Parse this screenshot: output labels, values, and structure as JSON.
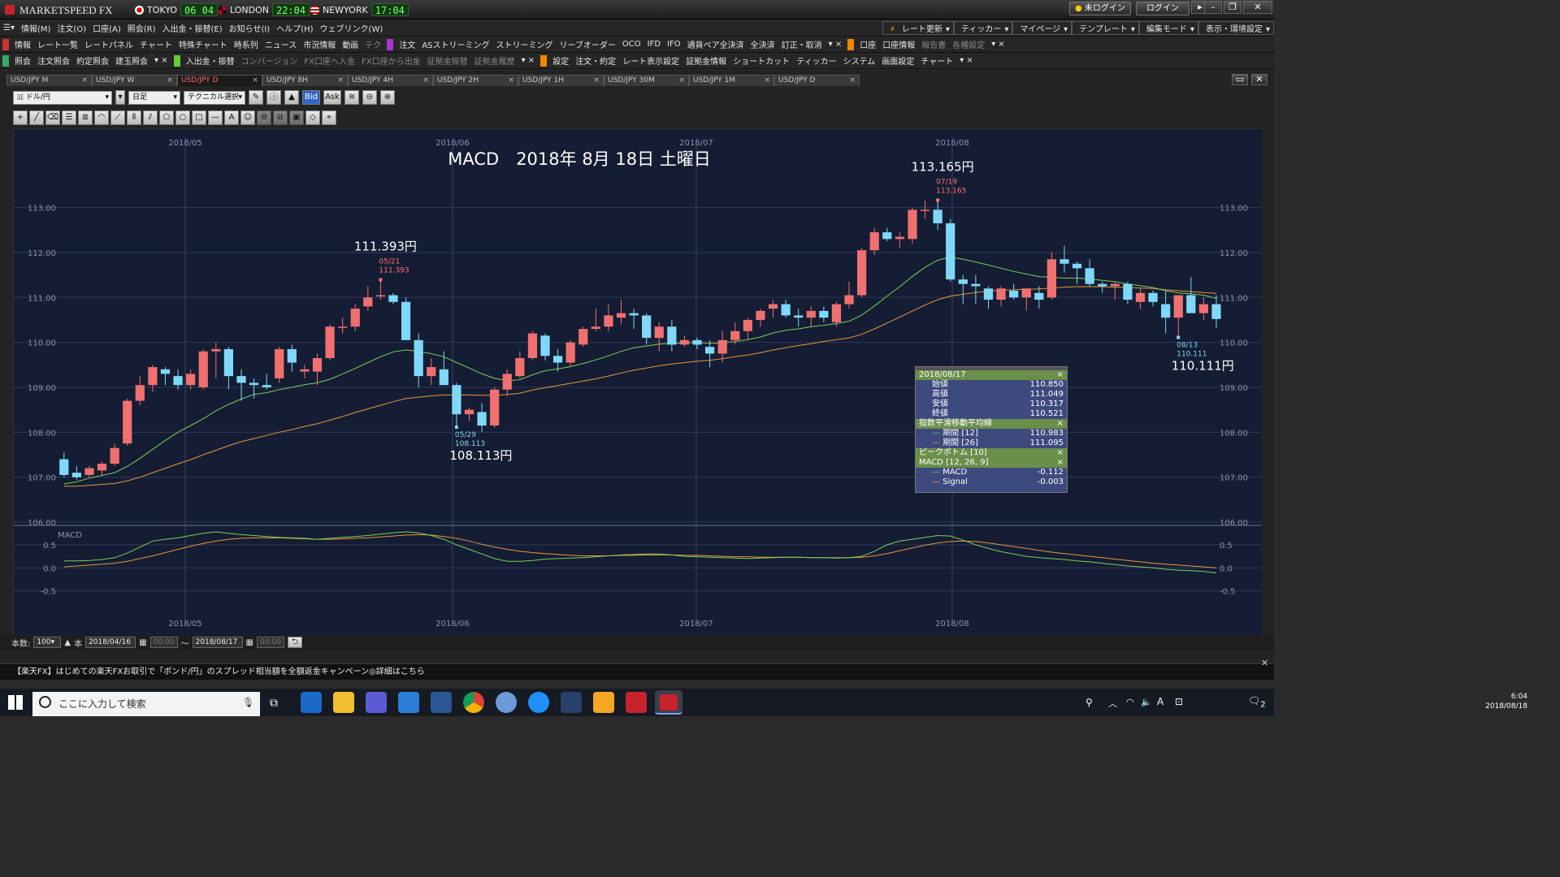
{
  "titlebar": {
    "brand": "MARKETSPEED FX",
    "clocks": [
      {
        "city": "TOKYO",
        "time": "06 04"
      },
      {
        "city": "LONDON",
        "time": "22:04"
      },
      {
        "city": "NEWYORK",
        "time": "17:04"
      }
    ],
    "login_status": "未ログイン",
    "login_button": "ログイン"
  },
  "menu1": [
    "情報(M)",
    "注文(O)",
    "口座(A)",
    "照会(R)",
    "入出金・振替(E)",
    "お知らせ(I)",
    "ヘルプ(H)",
    "ウェブリンク(W)"
  ],
  "menu1_right": [
    "レート更新",
    "ティッカー",
    "マイページ",
    "テンプレート",
    "編集モード",
    "表示・環境設定"
  ],
  "row2_info": [
    "情報",
    "レート一覧",
    "レートパネル",
    "チャート",
    "特殊チャート",
    "時系列",
    "ニュース",
    "市況情報",
    "動画",
    "テク"
  ],
  "row2_order": [
    "注文",
    "ASストリーミング",
    "ストリーミング",
    "リーブオーダー",
    "OCO",
    "IFD",
    "IFO",
    "通貨ペア全決済",
    "全決済",
    "訂正・取消"
  ],
  "row2_account": [
    "口座",
    "口座情報",
    "報告書",
    "各種設定"
  ],
  "row3_query": [
    "照会",
    "注文照会",
    "約定照会",
    "建玉照会"
  ],
  "row3_transfer": [
    "入出金・振替",
    "コンバージョン",
    "FX口座へ入金",
    "FX口座から出金",
    "証拠金振替",
    "証拠金履歴"
  ],
  "row3_settings": [
    "設定",
    "注文・約定",
    "レート表示設定",
    "証拠金情報",
    "ショートカット",
    "ティッカー",
    "システム",
    "画面設定",
    "チャート"
  ],
  "tabs": [
    "USD/JPY M",
    "USD/JPY W",
    "USD/JPY D",
    "USD/JPY 8H",
    "USD/JPY 4H",
    "USD/JPY 2H",
    "USD/JPY 1H",
    "USD/JPY 30M",
    "USD/JPY 1M",
    "USD/JPY D"
  ],
  "active_tab": 2,
  "toolbar": {
    "pair": "ドル/円",
    "period": "日足",
    "technical": "テクニカル選択",
    "bid": "Bid",
    "ask": "Ask"
  },
  "chart_data": {
    "type": "candlestick",
    "title": "MACD　2018年 8月 18日 土曜日",
    "x_ticks": [
      "2018/05",
      "2018/06",
      "2018/07",
      "2018/08"
    ],
    "ylim": [
      106.0,
      113.3
    ],
    "y_ticks": [
      "113.00",
      "112.00",
      "111.00",
      "110.00",
      "109.00",
      "108.00",
      "107.00",
      "106.00"
    ],
    "candles": [
      [
        107.4,
        107.55,
        107.0,
        107.05
      ],
      [
        107.1,
        107.25,
        106.95,
        107.0
      ],
      [
        107.05,
        107.25,
        107.0,
        107.2
      ],
      [
        107.15,
        107.35,
        107.05,
        107.3
      ],
      [
        107.3,
        107.75,
        107.25,
        107.65
      ],
      [
        107.75,
        108.75,
        107.7,
        108.7
      ],
      [
        108.7,
        109.25,
        108.6,
        109.05
      ],
      [
        109.05,
        109.5,
        108.9,
        109.45
      ],
      [
        109.4,
        109.45,
        109.05,
        109.3
      ],
      [
        109.25,
        109.4,
        108.95,
        109.05
      ],
      [
        109.05,
        109.4,
        108.95,
        109.3
      ],
      [
        109.0,
        109.85,
        108.95,
        109.8
      ],
      [
        109.8,
        110.0,
        109.2,
        109.85
      ],
      [
        109.85,
        109.9,
        108.95,
        109.25
      ],
      [
        109.25,
        109.4,
        108.7,
        109.1
      ],
      [
        109.1,
        109.2,
        108.75,
        109.05
      ],
      [
        109.05,
        109.3,
        108.95,
        109.0
      ],
      [
        109.2,
        109.9,
        109.1,
        109.85
      ],
      [
        109.85,
        109.95,
        109.35,
        109.55
      ],
      [
        109.35,
        109.5,
        109.2,
        109.4
      ],
      [
        109.35,
        109.75,
        109.05,
        109.65
      ],
      [
        109.65,
        110.4,
        109.6,
        110.35
      ],
      [
        110.35,
        110.55,
        110.2,
        110.35
      ],
      [
        110.35,
        110.85,
        110.25,
        110.75
      ],
      [
        110.8,
        111.25,
        110.7,
        111.0
      ],
      [
        111.05,
        111.39,
        110.95,
        111.05
      ],
      [
        111.05,
        111.1,
        110.85,
        110.9
      ],
      [
        110.9,
        111.0,
        110.05,
        110.05
      ],
      [
        110.05,
        110.2,
        109.0,
        109.25
      ],
      [
        109.25,
        109.65,
        109.05,
        109.45
      ],
      [
        109.4,
        109.8,
        109.05,
        109.05
      ],
      [
        109.05,
        109.1,
        108.11,
        108.4
      ],
      [
        108.4,
        108.55,
        108.25,
        108.5
      ],
      [
        108.45,
        108.65,
        108.0,
        108.15
      ],
      [
        108.15,
        109.0,
        108.1,
        108.95
      ],
      [
        108.95,
        109.4,
        108.8,
        109.3
      ],
      [
        109.25,
        109.8,
        109.2,
        109.65
      ],
      [
        109.65,
        110.25,
        109.6,
        110.2
      ],
      [
        110.15,
        110.2,
        109.6,
        109.7
      ],
      [
        109.7,
        109.85,
        109.35,
        109.55
      ],
      [
        109.55,
        110.05,
        109.45,
        110.0
      ],
      [
        109.95,
        110.35,
        109.9,
        110.3
      ],
      [
        110.3,
        110.75,
        110.25,
        110.35
      ],
      [
        110.35,
        110.85,
        110.25,
        110.6
      ],
      [
        110.55,
        110.95,
        110.4,
        110.65
      ],
      [
        110.65,
        110.75,
        110.3,
        110.6
      ],
      [
        110.6,
        110.65,
        109.95,
        110.1
      ],
      [
        110.1,
        110.45,
        109.8,
        110.35
      ],
      [
        110.35,
        110.5,
        109.8,
        109.95
      ],
      [
        109.95,
        110.15,
        109.9,
        110.05
      ],
      [
        110.05,
        110.1,
        109.85,
        109.95
      ],
      [
        109.9,
        110.05,
        109.45,
        109.75
      ],
      [
        109.75,
        110.25,
        109.55,
        110.05
      ],
      [
        110.05,
        110.45,
        109.95,
        110.25
      ],
      [
        110.25,
        110.55,
        110.05,
        110.5
      ],
      [
        110.5,
        110.75,
        110.35,
        110.7
      ],
      [
        110.75,
        110.95,
        110.55,
        110.85
      ],
      [
        110.85,
        110.95,
        110.55,
        110.6
      ],
      [
        110.6,
        110.75,
        110.35,
        110.55
      ],
      [
        110.55,
        110.8,
        110.35,
        110.7
      ],
      [
        110.7,
        110.8,
        110.45,
        110.55
      ],
      [
        110.45,
        110.9,
        110.35,
        110.85
      ],
      [
        110.85,
        111.35,
        110.75,
        111.05
      ],
      [
        111.05,
        112.1,
        111.0,
        112.05
      ],
      [
        112.05,
        112.55,
        111.95,
        112.45
      ],
      [
        112.45,
        112.55,
        112.25,
        112.3
      ],
      [
        112.3,
        112.45,
        112.1,
        112.35
      ],
      [
        112.3,
        113.0,
        112.2,
        112.95
      ],
      [
        112.95,
        113.15,
        112.75,
        112.95
      ],
      [
        112.95,
        113.17,
        112.5,
        112.65
      ],
      [
        112.65,
        112.75,
        111.35,
        111.4
      ],
      [
        111.4,
        111.5,
        110.85,
        111.3
      ],
      [
        111.3,
        111.5,
        110.85,
        111.25
      ],
      [
        111.2,
        111.25,
        110.75,
        110.95
      ],
      [
        110.95,
        111.25,
        110.8,
        111.2
      ],
      [
        111.15,
        111.3,
        110.95,
        111.0
      ],
      [
        111.0,
        111.2,
        110.7,
        111.2
      ],
      [
        111.1,
        111.25,
        110.75,
        110.95
      ],
      [
        111.0,
        112.0,
        110.95,
        111.85
      ],
      [
        111.85,
        112.15,
        111.55,
        111.75
      ],
      [
        111.75,
        111.8,
        111.3,
        111.65
      ],
      [
        111.65,
        111.85,
        111.25,
        111.3
      ],
      [
        111.3,
        111.35,
        111.1,
        111.25
      ],
      [
        111.25,
        111.35,
        110.95,
        111.3
      ],
      [
        111.3,
        111.35,
        110.85,
        110.95
      ],
      [
        110.9,
        111.2,
        110.75,
        111.1
      ],
      [
        111.1,
        111.15,
        110.8,
        110.9
      ],
      [
        110.85,
        111.15,
        110.2,
        110.55
      ],
      [
        110.55,
        111.0,
        110.11,
        111.05
      ],
      [
        111.05,
        111.45,
        110.7,
        110.65
      ],
      [
        110.65,
        111.0,
        110.5,
        110.85
      ],
      [
        110.85,
        111.05,
        110.32,
        110.52
      ]
    ],
    "ema12": [
      106.85,
      106.9,
      106.98,
      107.04,
      107.1,
      107.24,
      107.42,
      107.62,
      107.82,
      108.0,
      108.15,
      108.3,
      108.48,
      108.62,
      108.74,
      108.84,
      108.88,
      108.95,
      109.0,
      109.06,
      109.1,
      109.18,
      109.3,
      109.42,
      109.55,
      109.68,
      109.79,
      109.83,
      109.8,
      109.75,
      109.68,
      109.55,
      109.43,
      109.3,
      109.2,
      109.15,
      109.17,
      109.28,
      109.37,
      109.41,
      109.46,
      109.53,
      109.61,
      109.7,
      109.8,
      109.88,
      109.92,
      109.96,
      109.98,
      109.99,
      110.0,
      109.98,
      109.99,
      110.02,
      110.06,
      110.12,
      110.21,
      110.27,
      110.3,
      110.35,
      110.38,
      110.42,
      110.47,
      110.61,
      110.81,
      111.03,
      111.24,
      111.47,
      111.67,
      111.83,
      111.9,
      111.85,
      111.79,
      111.72,
      111.65,
      111.58,
      111.52,
      111.46,
      111.45,
      111.43,
      111.43,
      111.41,
      111.38,
      111.35,
      111.3,
      111.26,
      111.22,
      111.15,
      111.1,
      111.08,
      111.05,
      110.98
    ],
    "ema26": [
      106.8,
      106.8,
      106.82,
      106.84,
      106.86,
      106.92,
      107.0,
      107.1,
      107.2,
      107.3,
      107.39,
      107.5,
      107.6,
      107.7,
      107.79,
      107.86,
      107.93,
      108.0,
      108.06,
      108.13,
      108.19,
      108.27,
      108.35,
      108.44,
      108.52,
      108.6,
      108.68,
      108.75,
      108.78,
      108.81,
      108.83,
      108.83,
      108.83,
      108.82,
      108.82,
      108.84,
      108.87,
      108.94,
      108.99,
      109.04,
      109.09,
      109.14,
      109.19,
      109.25,
      109.32,
      109.38,
      109.43,
      109.48,
      109.52,
      109.55,
      109.58,
      109.6,
      109.64,
      109.68,
      109.72,
      109.77,
      109.83,
      109.88,
      109.93,
      109.97,
      110.02,
      110.06,
      110.1,
      110.18,
      110.3,
      110.43,
      110.56,
      110.7,
      110.83,
      110.95,
      111.03,
      111.07,
      111.11,
      111.14,
      111.16,
      111.17,
      111.18,
      111.19,
      111.21,
      111.23,
      111.24,
      111.24,
      111.24,
      111.23,
      111.22,
      111.21,
      111.2,
      111.17,
      111.15,
      111.13,
      111.11,
      111.09
    ],
    "peaks": [
      {
        "idx": 25,
        "date": "05/21",
        "price": "111.393",
        "label": "111.393円",
        "kind": "high"
      },
      {
        "idx": 31,
        "date": "05/29",
        "price": "108.113",
        "label": "108.113円",
        "kind": "low"
      },
      {
        "idx": 69,
        "date": "07/19",
        "price": "113.165",
        "label": "113.165円",
        "kind": "high"
      },
      {
        "idx": 88,
        "date": "08/13",
        "price": "110.111",
        "label": "110.111円",
        "kind": "low"
      }
    ],
    "macd": {
      "label": "MACD",
      "y_ticks": [
        "0.5",
        "0.0",
        "-0.5"
      ],
      "ylim": [
        -0.7,
        0.85
      ],
      "macd": [
        0.15,
        0.15,
        0.16,
        0.18,
        0.22,
        0.32,
        0.45,
        0.58,
        0.62,
        0.65,
        0.7,
        0.75,
        0.78,
        0.75,
        0.72,
        0.7,
        0.68,
        0.66,
        0.65,
        0.64,
        0.62,
        0.64,
        0.66,
        0.68,
        0.7,
        0.73,
        0.76,
        0.78,
        0.76,
        0.7,
        0.62,
        0.5,
        0.4,
        0.3,
        0.2,
        0.14,
        0.14,
        0.16,
        0.19,
        0.2,
        0.21,
        0.22,
        0.24,
        0.26,
        0.28,
        0.29,
        0.3,
        0.3,
        0.28,
        0.25,
        0.24,
        0.23,
        0.22,
        0.21,
        0.2,
        0.21,
        0.22,
        0.23,
        0.23,
        0.22,
        0.22,
        0.21,
        0.22,
        0.25,
        0.36,
        0.5,
        0.58,
        0.62,
        0.66,
        0.7,
        0.69,
        0.6,
        0.5,
        0.42,
        0.35,
        0.3,
        0.25,
        0.22,
        0.2,
        0.18,
        0.15,
        0.13,
        0.1,
        0.07,
        0.04,
        0.02,
        0.0,
        -0.03,
        -0.05,
        -0.06,
        -0.08,
        -0.11
      ],
      "signal": [
        0.02,
        0.04,
        0.06,
        0.08,
        0.1,
        0.14,
        0.2,
        0.26,
        0.33,
        0.4,
        0.47,
        0.53,
        0.58,
        0.62,
        0.64,
        0.65,
        0.65,
        0.65,
        0.64,
        0.63,
        0.62,
        0.62,
        0.63,
        0.64,
        0.65,
        0.67,
        0.69,
        0.71,
        0.72,
        0.71,
        0.68,
        0.64,
        0.58,
        0.51,
        0.45,
        0.4,
        0.36,
        0.33,
        0.31,
        0.29,
        0.27,
        0.26,
        0.26,
        0.26,
        0.27,
        0.27,
        0.28,
        0.28,
        0.28,
        0.27,
        0.27,
        0.26,
        0.25,
        0.24,
        0.24,
        0.23,
        0.23,
        0.23,
        0.23,
        0.22,
        0.22,
        0.22,
        0.22,
        0.23,
        0.26,
        0.31,
        0.37,
        0.43,
        0.49,
        0.54,
        0.57,
        0.58,
        0.57,
        0.54,
        0.5,
        0.46,
        0.42,
        0.38,
        0.34,
        0.31,
        0.28,
        0.25,
        0.22,
        0.19,
        0.16,
        0.13,
        0.1,
        0.08,
        0.06,
        0.04,
        0.02,
        0.0
      ]
    },
    "info": {
      "date": "2018/08/17",
      "ohlc": [
        [
          "始値",
          "110.850"
        ],
        [
          "高値",
          "111.049"
        ],
        [
          "安値",
          "110.317"
        ],
        [
          "終値",
          "110.521"
        ]
      ],
      "ema_title": "指数平滑移動平均線",
      "ema": [
        [
          "期間 [12]",
          "110.983"
        ],
        [
          "期間 [26]",
          "111.095"
        ]
      ],
      "peak_title": "ピークボトム [10]",
      "macd_title": "MACD [12, 26, 9]",
      "macd_vals": [
        [
          "MACD",
          "-0.112"
        ],
        [
          "Signal",
          "-0.003"
        ]
      ]
    },
    "colors": {
      "up": "#f07070",
      "down": "#80d8f8",
      "ema12": "#7bcf5a",
      "ema26": "#e8963e",
      "bg": "#141d33"
    }
  },
  "bottom": {
    "count_label": "本数:",
    "count": "100",
    "unit": "本",
    "from": "2018/04/16",
    "tilde": "～",
    "to": "2018/08/17",
    "time_placeholder": "00:00"
  },
  "news": "【楽天FX】はじめての楽天FXお取引で「ポンド/円」のスプレッド相当額を全額返金キャンペーン◎詳細はこちら",
  "taskbar": {
    "search_placeholder": "ここに入力して検索",
    "time": "6:04",
    "date": "2018/08/18",
    "ime": "A",
    "notif": "2"
  }
}
